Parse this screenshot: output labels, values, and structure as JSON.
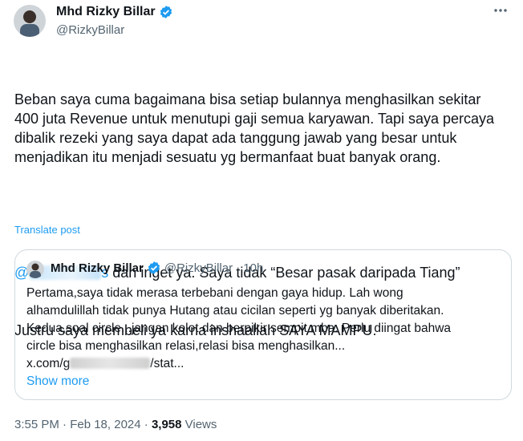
{
  "author": {
    "name": "Mhd Rizky Billar",
    "handle": "@RizkyBillar"
  },
  "more_icon": "more-horizontal-icon",
  "tweet": {
    "paragraph1": "Beban saya cuma bagaimana bisa setiap bulannya menghasilkan sekitar 400 juta Revenue untuk menutupi gaji semua karyawan. Tapi saya percaya dibalik rezeki yang saya dapat ada tanggung jawab yang besar untuk menjadikan itu menjadi sesuatu yg bermanfaat buat banyak orang.",
    "mention_prefix": "@",
    "mention_suffix": "s",
    "line2_rest": " dan inget ya. Saya tidak “Besar pasak daripada Tiang”",
    "line3": "Justru saya membeli ya karna inshaallah SAYA MAMPU."
  },
  "translate_label": "Translate post",
  "quote": {
    "name": "Mhd Rizky Billar",
    "handle": "@RizkyBillar",
    "time": "· 10h",
    "lines": [
      "Pertama,saya tidak merasa terbebani dengan gaya hidup. Lah wong",
      "alhamdulillah tidak punya Hutang atau cicilan seperti yg banyak diberitakan.",
      "Kedua,soal circle...jangan kolot dan berpikir sempit mba. Perlu diingat bahwa",
      "circle bisa menghasilkan relasi,relasi bisa menghasilkan..."
    ],
    "link_prefix": "x.com/g",
    "link_suffix": "/stat...",
    "show_more": "Show more"
  },
  "footer": {
    "time": "3:55 PM · Feb 18, 2024 · ",
    "views_count": "3,958",
    "views_label": " Views"
  },
  "colors": {
    "accent": "#1d9bf0",
    "secondary_text": "#536471",
    "border": "#cfd9de"
  }
}
